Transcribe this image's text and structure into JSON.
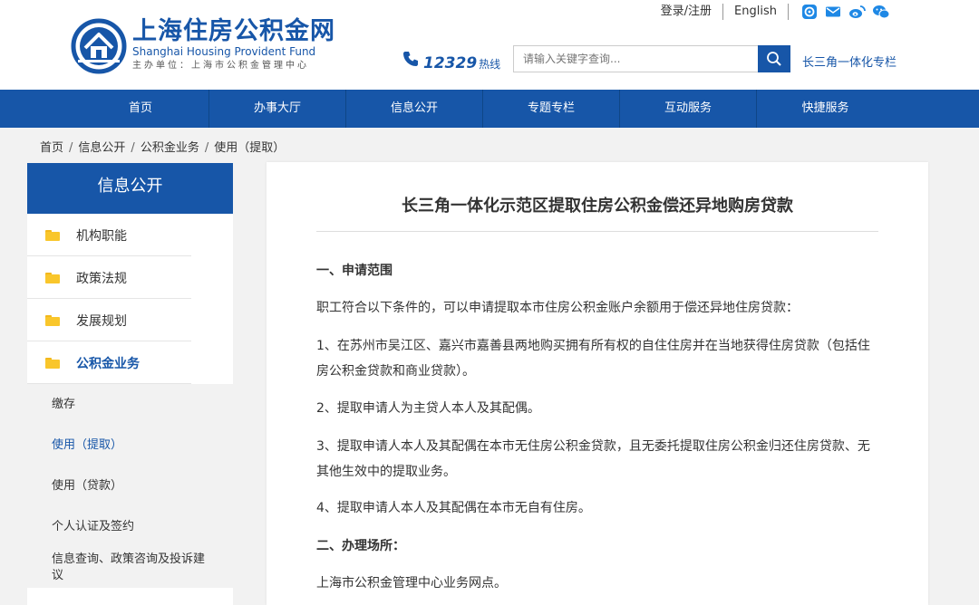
{
  "header": {
    "logo_cn": "上海住房公积金网",
    "logo_en": "Shanghai Housing Provident Fund",
    "logo_sub": "主办单位：上海市公积金管理中心",
    "login_label": "登录/注册",
    "english_label": "English",
    "hotline_number": "12329",
    "hotline_label": "热线",
    "search_placeholder": "请输入关键字查询...",
    "special_link": "长三角一体化专栏"
  },
  "nav": [
    "首页",
    "办事大厅",
    "信息公开",
    "专题专栏",
    "互动服务",
    "快捷服务"
  ],
  "breadcrumb": [
    "首页",
    "信息公开",
    "公积金业务",
    "使用（提取）"
  ],
  "sidebar": {
    "title": "信息公开",
    "items": [
      "机构职能",
      "政策法规",
      "发展规划",
      "公积金业务"
    ],
    "active_item": "公积金业务",
    "subitems": [
      "缴存",
      "使用（提取）",
      "使用（贷款）",
      "个人认证及签约",
      "信息查询、政策咨询及投诉建议"
    ],
    "current_subitem": "使用（提取）"
  },
  "article": {
    "title": "长三角一体化示范区提取住房公积金偿还异地购房贷款",
    "sections": [
      {
        "type": "head",
        "text": "一、申请范围"
      },
      {
        "type": "text",
        "text": "职工符合以下条件的，可以申请提取本市住房公积金账户余额用于偿还异地住房贷款："
      },
      {
        "type": "text",
        "text": "1、在苏州市吴江区、嘉兴市嘉善县两地购买拥有所有权的自住住房并在当地获得住房贷款（包括住房公积金贷款和商业贷款）。"
      },
      {
        "type": "text",
        "text": "2、提取申请人为主贷人本人及其配偶。"
      },
      {
        "type": "text",
        "text": "3、提取申请人本人及其配偶在本市无住房公积金贷款，且无委托提取住房公积金归还住房贷款、无其他生效中的提取业务。"
      },
      {
        "type": "text",
        "text": "4、提取申请人本人及其配偶在本市无自有住房。"
      },
      {
        "type": "head",
        "text": "二、办理场所："
      },
      {
        "type": "text",
        "text": "上海市公积金管理中心业务网点。"
      }
    ]
  },
  "colors": {
    "primary": "#1756a8",
    "folder": "#f9c62b",
    "background": "#f2f2f2"
  },
  "icons": [
    "house-logo-icon",
    "phone-icon",
    "search-icon",
    "app-icon",
    "mail-icon",
    "weibo-icon",
    "wechat-icon",
    "folder-icon"
  ]
}
